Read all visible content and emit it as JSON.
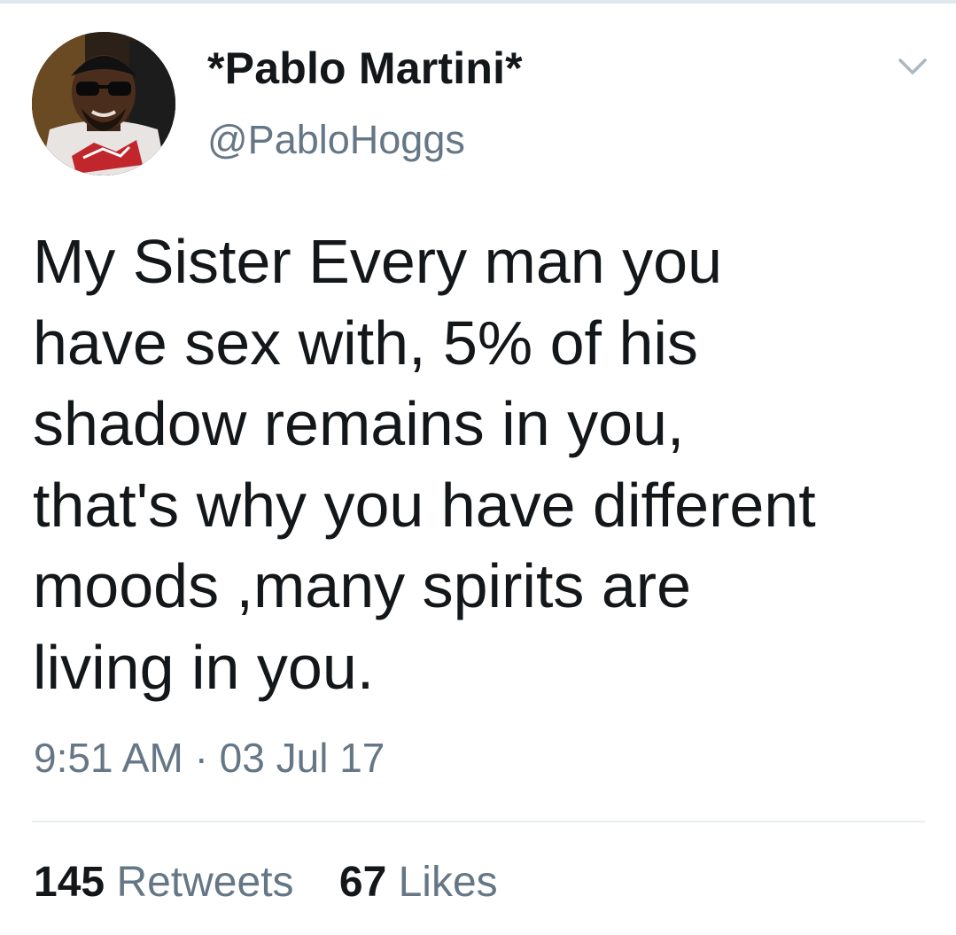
{
  "tweet": {
    "display_name": "*Pablo Martini*",
    "handle": "@PabloHoggs",
    "text": "My Sister Every man you\nhave sex with, 5% of his\nshadow remains in you,\nthat's why you have different\nmoods ,many spirits are\nliving in you.",
    "time": "9:51 AM",
    "separator": "·",
    "date": "03 Jul 17",
    "retweets": {
      "count": "145",
      "label": "Retweets"
    },
    "likes": {
      "count": "67",
      "label": "Likes"
    }
  },
  "icons": {
    "more": "chevron-down-icon",
    "avatar": "avatar"
  },
  "colors": {
    "text": "#14171a",
    "secondary": "#657786",
    "divider": "#e6ecf0"
  }
}
